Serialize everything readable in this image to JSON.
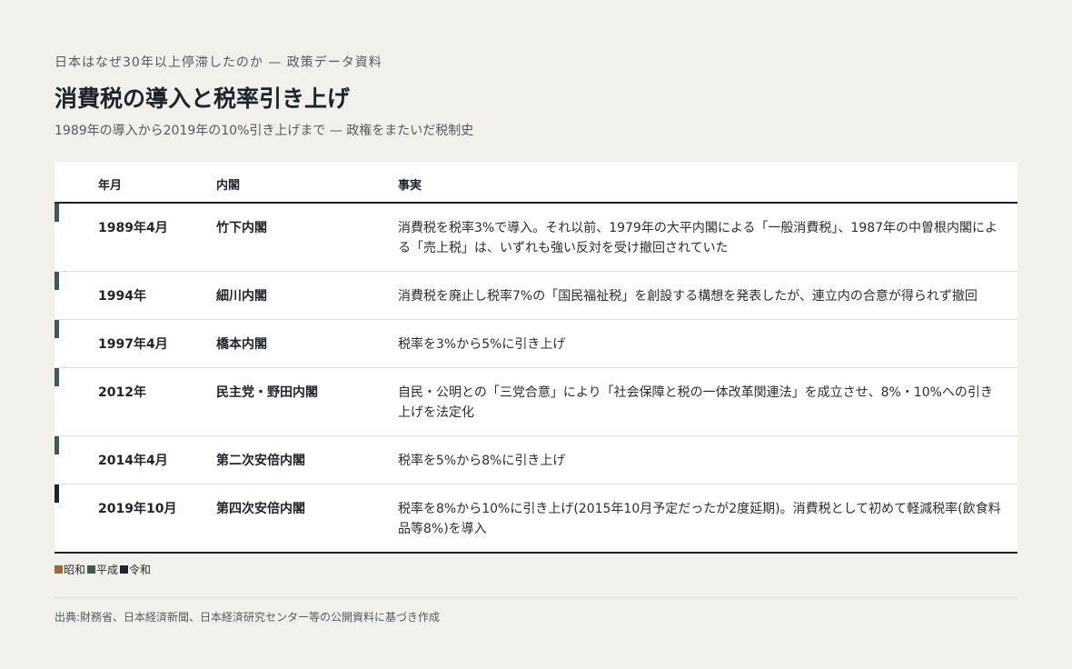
{
  "header": {
    "kicker": "日本はなぜ30年以上停滞したのか — 政策データ資料",
    "title": "消費税の導入と税率引き上げ",
    "subtitle": "1989年の導入から2019年の10%引き上げまで — 政権をまたいだ税制史"
  },
  "table": {
    "columns": [
      "年月",
      "内閣",
      "事実"
    ],
    "rows": [
      {
        "date": "1989年4月",
        "cabinet": "竹下内閣",
        "fact": "消費税を税率3%で導入。それ以前、1979年の大平内閣による「一般消費税」、1987年の中曽根内閣による「売上税」は、いずれも強い反対を受け撤回されていた",
        "era": "平成",
        "color": "#3f5a4f"
      },
      {
        "date": "1994年",
        "cabinet": "細川内閣",
        "fact": "消費税を廃止し税率7%の「国民福祉税」を創設する構想を発表したが、連立内の合意が得られず撤回",
        "era": "平成",
        "color": "#3f5a4f"
      },
      {
        "date": "1997年4月",
        "cabinet": "橋本内閣",
        "fact": "税率を3%から5%に引き上げ",
        "era": "平成",
        "color": "#3f5a4f"
      },
      {
        "date": "2012年",
        "cabinet": "民主党・野田内閣",
        "fact": "自民・公明との「三党合意」により「社会保障と税の一体改革関連法」を成立させ、8%・10%への引き上げを法定化",
        "era": "平成",
        "color": "#3f5a4f"
      },
      {
        "date": "2014年4月",
        "cabinet": "第二次安倍内閣",
        "fact": "税率を5%から8%に引き上げ",
        "era": "平成",
        "color": "#3f5a4f"
      },
      {
        "date": "2019年10月",
        "cabinet": "第四次安倍内閣",
        "fact": "税率を8%から10%に引き上げ(2015年10月予定だったが2度延期)。消費税として初めて軽減税率(飲食料品等8%)を導入",
        "era": "令和",
        "color": "#1f2433"
      }
    ]
  },
  "legend": [
    {
      "label": "昭和",
      "color": "#9a6a36"
    },
    {
      "label": "平成",
      "color": "#3f5a4f"
    },
    {
      "label": "令和",
      "color": "#1f2433"
    }
  ],
  "source": "出典:財務省、日本経済新聞、日本経済研究センター等の公開資料に基づき作成"
}
